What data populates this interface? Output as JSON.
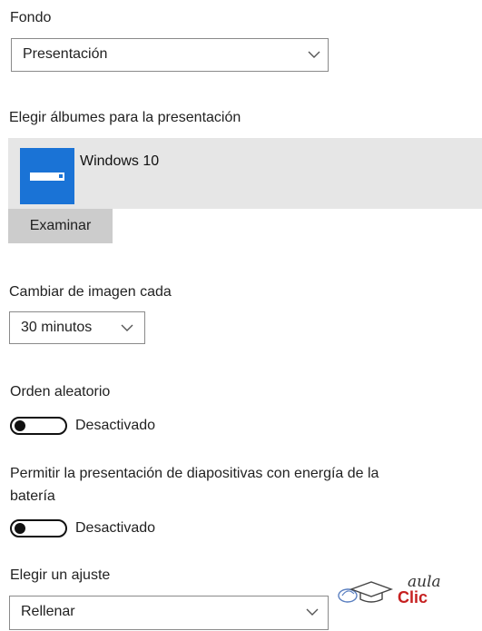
{
  "background": {
    "label": "Fondo",
    "selected": "Presentación"
  },
  "albums": {
    "label": "Elegir álbumes para la presentación",
    "items": [
      {
        "name": "Windows 10"
      }
    ],
    "browse_label": "Examinar"
  },
  "interval": {
    "label": "Cambiar de imagen cada",
    "selected": "30 minutos"
  },
  "shuffle": {
    "label": "Orden aleatorio",
    "state_label": "Desactivado",
    "on": false
  },
  "battery": {
    "label_line1": "Permitir la presentación de diapositivas con energía de la",
    "label_line2": "batería",
    "state_label": "Desactivado",
    "on": false
  },
  "fit": {
    "label": "Elegir un ajuste",
    "selected": "Rellenar"
  },
  "watermark": {
    "text_top": "aula",
    "text_bottom": "Clic"
  },
  "colors": {
    "accent": "#1a73d6",
    "album_bg": "#e6e6e6",
    "button_bg": "#cccccc",
    "watermark_red": "#c62020"
  },
  "icons": [
    "chevron-down-icon",
    "album-icon",
    "toggle-switch",
    "aulaclic-logo"
  ]
}
